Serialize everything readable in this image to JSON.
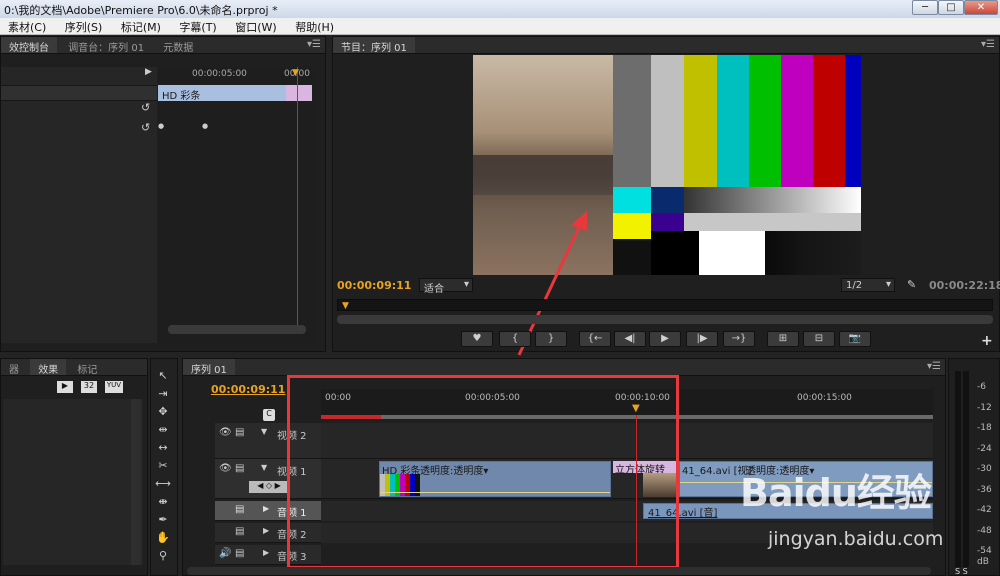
{
  "window": {
    "title": "0:\\我的文档\\Adobe\\Premiere Pro\\6.0\\未命名.prproj *",
    "minimize": "─",
    "maximize": "□",
    "close": "✕"
  },
  "menu": [
    "素材(C)",
    "序列(S)",
    "标记(M)",
    "字幕(T)",
    "窗口(W)",
    "帮助(H)"
  ],
  "effect_controls": {
    "tabs": [
      "效控制台",
      "调音台：序列 01",
      "元数据"
    ],
    "ruler_time": "00:00:05:00",
    "ruler_time2": "00:00",
    "clip_name": "HD 彩条"
  },
  "program_monitor": {
    "tab": "节目：序列 01",
    "timecode": "00:00:09:11",
    "fit_label": "适合",
    "resolution": "1/2",
    "duration": "00:00:22:18",
    "buttons": [
      "♥",
      "{",
      "}",
      "{←",
      "◀|",
      "▶",
      "|▶",
      "→}",
      "⊞",
      "⊟",
      "📷"
    ],
    "plus": "+"
  },
  "project_panel": {
    "tabs": [
      "器",
      "效果",
      "标记"
    ],
    "icons": [
      "32",
      "YUV"
    ]
  },
  "timeline": {
    "tab": "序列 01",
    "timecode": "00:00:09:11",
    "ruler": [
      "00:00",
      "00:00:05:00",
      "00:00:10:00",
      "00:00:15:00"
    ],
    "tracks": {
      "video2": "视频 2",
      "video1": "视频 1",
      "audio1": "音频 1",
      "audio2": "音频 2",
      "audio3": "音频 3"
    },
    "clips": {
      "bars_label": "HD 彩条",
      "bars_opacity": "透明度:透明度▾",
      "transition": "立方体旋转",
      "avi_label": "41_64.avi [视]",
      "avi_opacity": "透明度:透明度▾",
      "audio_label": "41_64.avi [音]"
    }
  },
  "audio_meter": {
    "labels": [
      "-6",
      "-12",
      "-18",
      "-24",
      "-30",
      "-36",
      "-42",
      "-48",
      "-54",
      "dB"
    ],
    "solo": "S  S"
  },
  "watermark": {
    "brand": "Baidu经验",
    "url": "jingyan.baidu.com"
  },
  "colors": {
    "timecode": "#e9a321",
    "highlight": "#e8383c",
    "clip_video": "#7f9bbf",
    "playhead": "#c8272b"
  }
}
